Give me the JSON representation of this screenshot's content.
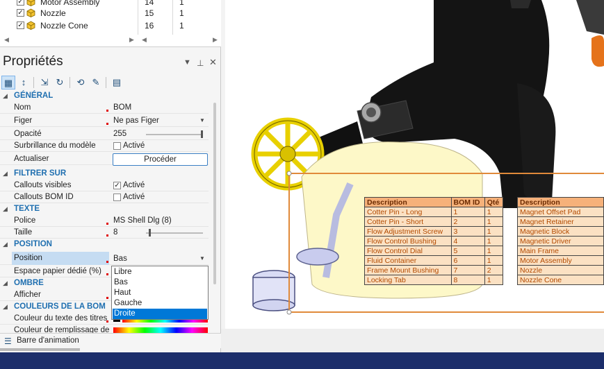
{
  "tree": {
    "rows": [
      {
        "name": "Motor Assembly",
        "qty": "14",
        "num": "1"
      },
      {
        "name": "Nozzle",
        "qty": "15",
        "num": "1"
      },
      {
        "name": "Nozzle Cone",
        "qty": "16",
        "num": "1"
      }
    ]
  },
  "properties": {
    "title": "Propriétés",
    "categories": {
      "general": "GÉNÉRAL",
      "filter": "FILTRER SUR",
      "text": "TEXTE",
      "position": "POSITION",
      "shadow": "OMBRE",
      "colors": "COULEURS DE LA BOM"
    },
    "rows": {
      "nom": {
        "label": "Nom",
        "value": "BOM"
      },
      "figer": {
        "label": "Figer",
        "value": "Ne pas Figer"
      },
      "opacite": {
        "label": "Opacité",
        "value": "255",
        "level": 1.0
      },
      "surbrillance": {
        "label": "Surbrillance du modèle",
        "value": "Activé",
        "checked": false
      },
      "actualiser": {
        "label": "Actualiser",
        "button": "Procéder"
      },
      "callouts_visibles": {
        "label": "Callouts visibles",
        "value": "Activé",
        "checked": true
      },
      "callouts_bom": {
        "label": "Callouts BOM ID",
        "value": "Activé",
        "checked": false
      },
      "police": {
        "label": "Police",
        "value": "MS Shell Dlg (8)"
      },
      "taille": {
        "label": "Taille",
        "value": "8",
        "level": 0.05
      },
      "position": {
        "label": "Position",
        "value": "Bas"
      },
      "espace": {
        "label": "Espace papier dédié (%)"
      },
      "afficher": {
        "label": "Afficher"
      },
      "couleur_titres": {
        "label": "Couleur du texte des titres",
        "color": "#000000"
      },
      "couleur_remplissage": {
        "label": "Couleur de remplissage de"
      }
    },
    "dropdown_options": [
      "Libre",
      "Bas",
      "Haut",
      "Gauche",
      "Droite"
    ],
    "dropdown_highlighted": "Droite"
  },
  "animation_bar": {
    "label": "Barre d'animation"
  },
  "bom_table_left": {
    "headers": [
      "Description",
      "BOM ID",
      "Qté"
    ],
    "rows": [
      [
        "Cotter Pin - Long",
        "1",
        "1"
      ],
      [
        "Cotter Pin - Short",
        "2",
        "1"
      ],
      [
        "Flow Adjustment Screw",
        "3",
        "1"
      ],
      [
        "Flow Control Bushing",
        "4",
        "1"
      ],
      [
        "Flow Control Dial",
        "5",
        "1"
      ],
      [
        "Fluid Container",
        "6",
        "1"
      ],
      [
        "Frame Mount Bushing",
        "7",
        "2"
      ],
      [
        "Locking Tab",
        "8",
        "1"
      ]
    ]
  },
  "bom_table_right": {
    "headers": [
      "Description"
    ],
    "rows": [
      [
        "Magnet Offset Pad"
      ],
      [
        "Magnet Retainer"
      ],
      [
        "Magnetic Block"
      ],
      [
        "Magnetic Driver"
      ],
      [
        "Main Frame"
      ],
      [
        "Motor Assembly"
      ],
      [
        "Nozzle"
      ],
      [
        "Nozzle Cone"
      ]
    ]
  },
  "colors": {
    "accent": "#1f6fb0",
    "selection": "#0078d7",
    "bom_header": "#f6b17a",
    "bom_cell": "#fbe1c3",
    "bottom_bar": "#1c2e6b"
  }
}
